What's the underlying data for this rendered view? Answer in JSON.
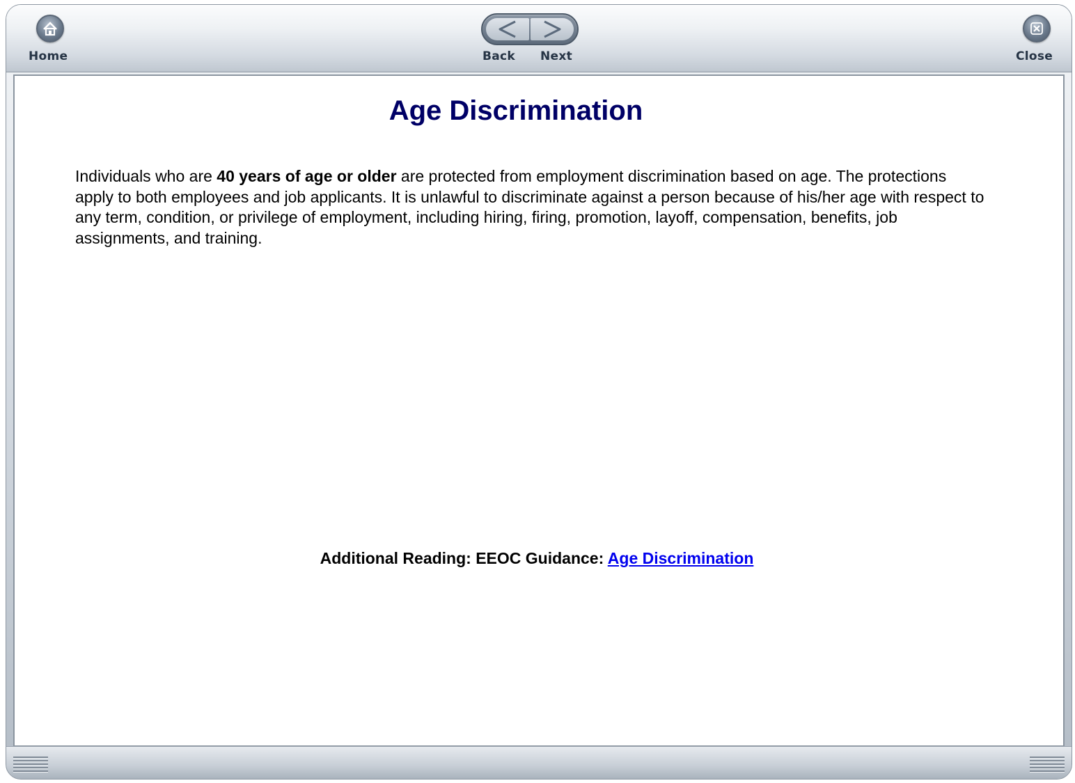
{
  "toolbar": {
    "home_label": "Home",
    "back_label": "Back",
    "next_label": "Next",
    "close_label": "Close"
  },
  "page": {
    "title": "Age Discrimination",
    "body_intro": "Individuals who are ",
    "body_bold": "40 years of age or older",
    "body_rest": " are protected from employment discrimination based on age. The protections apply to both employees and job applicants. It is unlawful to discriminate against a person because of his/her age with respect to any term, condition, or privilege of employment, including hiring, firing, promotion, layoff, compensation, benefits, job assignments, and training."
  },
  "additional_reading": {
    "label": "Additional Reading: EEOC Guidance: ",
    "link_text": "Age Discrimination"
  },
  "icons": {
    "home": "home-icon",
    "back": "arrow-left-icon",
    "next": "arrow-right-icon",
    "close": "close-icon",
    "grip": "resize-grip-icon"
  },
  "colors": {
    "title": "#000066",
    "link": "#0000ee",
    "chrome": "#c8cfd7"
  }
}
